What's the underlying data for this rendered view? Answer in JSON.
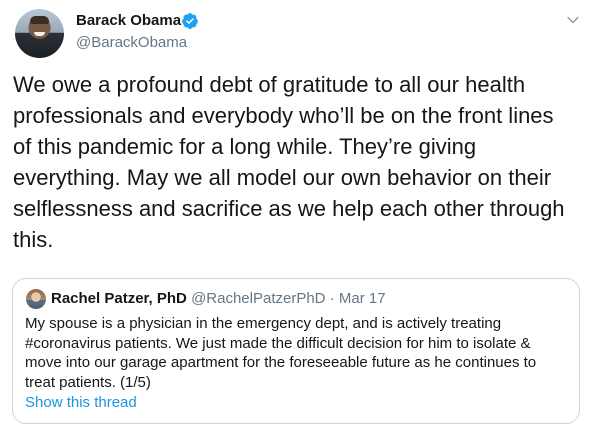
{
  "tweet": {
    "author": {
      "display_name": "Barack Obama",
      "handle": "@BarackObama",
      "verified": true
    },
    "text_lines": [
      "We owe a profound debt of gratitude to all our health",
      "professionals and everybody who’ll be on the front lines",
      "of this pandemic for a long while. They’re giving",
      "everything. May we all model our own behavior on their",
      "selflessness and sacrifice as we help each other through",
      "this."
    ],
    "menu_icon": "chevron-down-icon"
  },
  "quoted_tweet": {
    "display_name": "Rachel Patzer, PhD",
    "handle": "@RachelPatzerPhD",
    "separator": "·",
    "date": "Mar 17",
    "text_lines": [
      "My spouse is a physician in the emergency dept, and is actively treating",
      "#coronavirus patients. We just made the difficult decision for him to isolate &",
      "move into our garage apartment for the foreseeable future as he continues to",
      "treat patients. (1/5)"
    ],
    "show_thread_label": "Show this thread"
  },
  "colors": {
    "primary_text": "#14171a",
    "secondary_text": "#657786",
    "link": "#1b95e0",
    "verified_badge": "#1da1f2",
    "border": "#ccd6dd"
  }
}
